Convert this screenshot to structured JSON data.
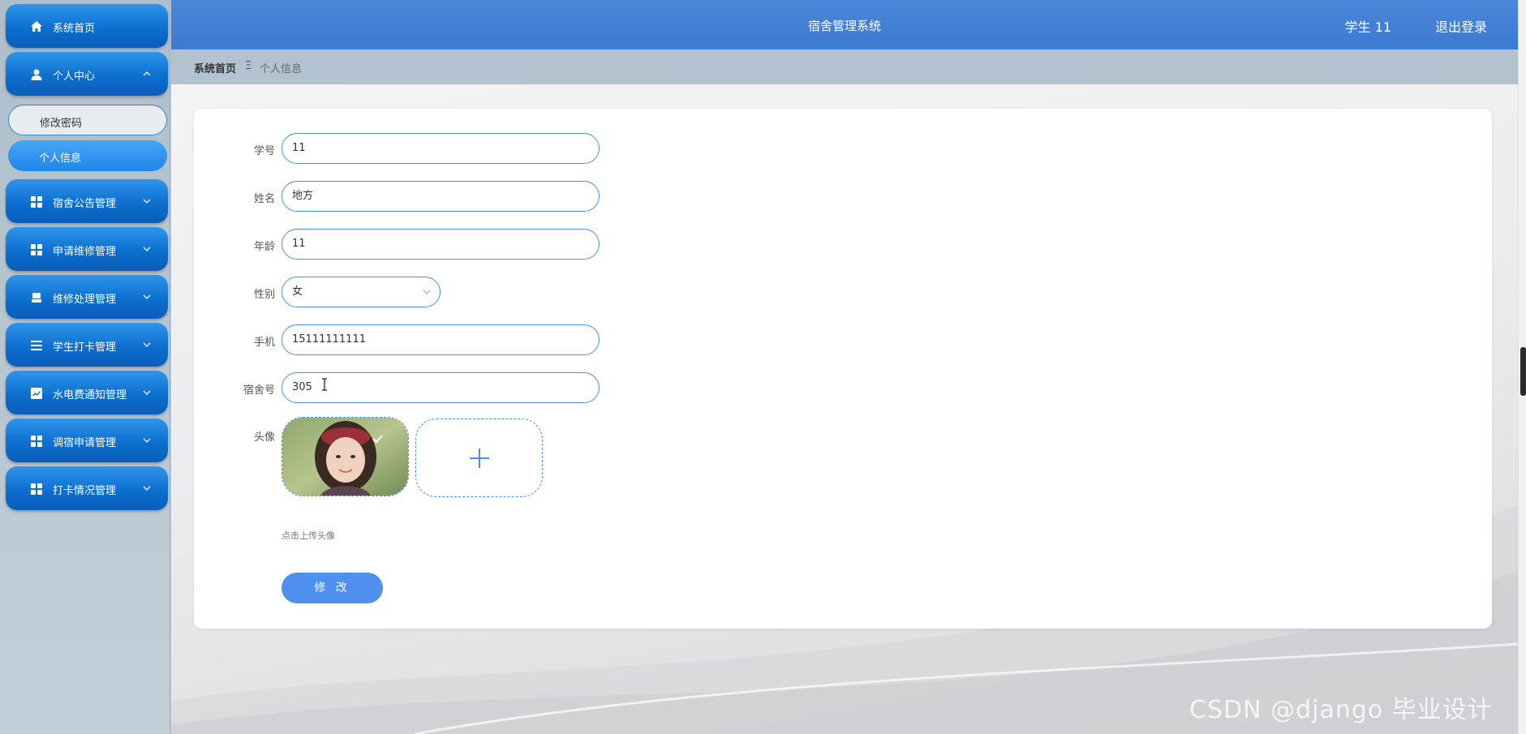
{
  "app": {
    "title": "宿舍管理系统",
    "user": "学生 11",
    "logout": "退出登录"
  },
  "sidebar": {
    "items": [
      {
        "label": "系统首页",
        "icon": "home-icon"
      },
      {
        "label": "个人中心",
        "icon": "user-icon",
        "expanded": true
      },
      {
        "label": "宿舍公告管理",
        "icon": "grid-icon"
      },
      {
        "label": "申请维修管理",
        "icon": "grid-icon"
      },
      {
        "label": "维修处理管理",
        "icon": "printer-icon"
      },
      {
        "label": "学生打卡管理",
        "icon": "list-icon"
      },
      {
        "label": "水电费通知管理",
        "icon": "chart-icon"
      },
      {
        "label": "调宿申请管理",
        "icon": "grid-icon"
      },
      {
        "label": "打卡情况管理",
        "icon": "grid-icon"
      }
    ],
    "subitems": [
      {
        "label": "修改密码"
      },
      {
        "label": "个人信息",
        "active": true
      }
    ]
  },
  "breadcrumb": {
    "home": "系统首页",
    "separator": "Ξ",
    "current": "个人信息"
  },
  "form": {
    "fields": [
      {
        "label": "学号",
        "value": "11"
      },
      {
        "label": "姓名",
        "value": "地方"
      },
      {
        "label": "年龄",
        "value": "11"
      },
      {
        "label": "性别",
        "value": "女"
      },
      {
        "label": "手机",
        "value": "15111111111"
      },
      {
        "label": "宿舍号",
        "value": "305"
      }
    ],
    "avatar_label": "头像",
    "upload_hint": "点击上传头像",
    "submit": "修 改"
  },
  "watermark": "CSDN @django 毕业设计",
  "colors": {
    "header": "#4080d4",
    "sidebar_button": "#0d6fd0",
    "accent": "#4d90ee"
  }
}
